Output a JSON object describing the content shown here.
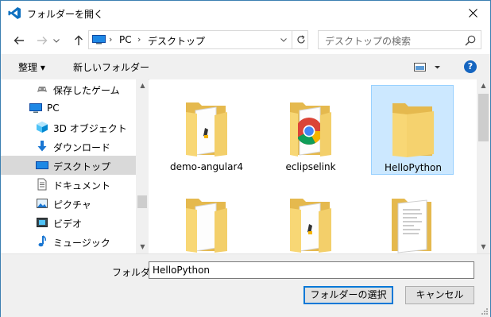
{
  "window": {
    "title": "フォルダーを開く",
    "app_icon": "vscode-icon",
    "accent": "#3c7fb1"
  },
  "address": {
    "crumbs": [
      "PC",
      "デスクトップ"
    ],
    "icon": "pc-icon"
  },
  "search": {
    "placeholder": "デスクトップの検索"
  },
  "toolbar": {
    "organize_label": "整理 ▾",
    "new_folder_label": "新しいフォルダー"
  },
  "nav": {
    "items": [
      {
        "label": "保存したゲーム",
        "icon": "saved-games-icon"
      },
      {
        "label": "PC",
        "icon": "pc-icon"
      },
      {
        "label": "3D オブジェクト",
        "icon": "3d-objects-icon"
      },
      {
        "label": "ダウンロード",
        "icon": "download-icon"
      },
      {
        "label": "デスクトップ",
        "icon": "desktop-icon",
        "selected": true
      },
      {
        "label": "ドキュメント",
        "icon": "documents-icon"
      },
      {
        "label": "ピクチャ",
        "icon": "pictures-icon"
      },
      {
        "label": "ビデオ",
        "icon": "videos-icon"
      },
      {
        "label": "ミュージック",
        "icon": "music-icon"
      }
    ]
  },
  "files": [
    {
      "name": "demo-angular4",
      "icon": "folder-icon"
    },
    {
      "name": "eclipselink",
      "icon": "chrome-folder-icon"
    },
    {
      "name": "HelloPython",
      "icon": "folder-icon",
      "selected": true
    },
    {
      "name": "",
      "icon": "folder-icon"
    },
    {
      "name": "",
      "icon": "folder-icon"
    },
    {
      "name": "",
      "icon": "document-icon"
    }
  ],
  "footer": {
    "folder_label": "フォルダー:",
    "folder_value": "HelloPython",
    "select_button": "フォルダーの選択",
    "cancel_button": "キャンセル"
  }
}
